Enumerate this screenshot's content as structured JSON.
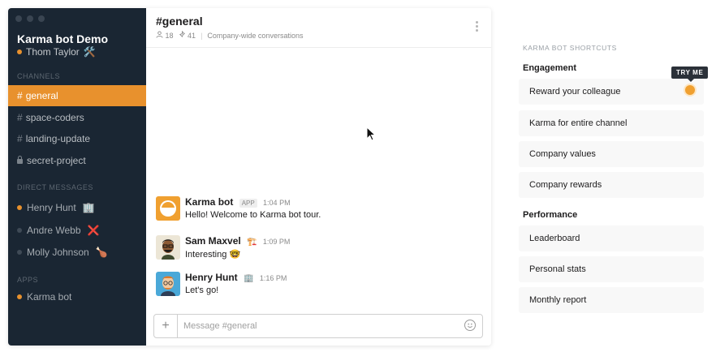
{
  "workspace": {
    "name": "Karma bot Demo",
    "user": "Thom Taylor",
    "user_emoji": "🛠️"
  },
  "sidebar": {
    "channels_title": "CHANNELS",
    "channels": [
      {
        "label": "general",
        "active": true,
        "private": false
      },
      {
        "label": "space-coders",
        "active": false,
        "private": false
      },
      {
        "label": "landing-update",
        "active": false,
        "private": false
      },
      {
        "label": "secret-project",
        "active": false,
        "private": true
      }
    ],
    "dm_title": "DIRECT MESSAGES",
    "dms": [
      {
        "label": "Henry Hunt",
        "emoji": "🏢",
        "online": true
      },
      {
        "label": "Andre Webb",
        "emoji": "❌",
        "online": false
      },
      {
        "label": "Molly Johnson",
        "emoji": "🍗",
        "online": false
      }
    ],
    "apps_title": "APPS",
    "apps": [
      {
        "label": "Karma bot",
        "online": true
      }
    ]
  },
  "header": {
    "channel": "#general",
    "members": "18",
    "pins": "41",
    "description": "Company-wide conversations"
  },
  "messages": [
    {
      "name": "Karma bot",
      "badge": "APP",
      "emoji": "",
      "time": "1:04 PM",
      "text": "Hello! Welcome to Karma bot tour.",
      "text_emoji": ""
    },
    {
      "name": "Sam Maxvel",
      "badge": "",
      "emoji": "🏗️",
      "time": "1:09 PM",
      "text": "Interesting",
      "text_emoji": "🤓"
    },
    {
      "name": "Henry Hunt",
      "badge": "",
      "emoji": "🏢",
      "time": "1:16 PM",
      "text": "Let's go!",
      "text_emoji": ""
    }
  ],
  "composer": {
    "placeholder": "Message #general"
  },
  "shortcuts": {
    "title": "KARMA BOT SHORTCUTS",
    "engagement_title": "Engagement",
    "engagement": [
      "Reward your colleague",
      "Karma for entire channel",
      "Company values",
      "Company rewards"
    ],
    "performance_title": "Performance",
    "performance": [
      "Leaderboard",
      "Personal stats",
      "Monthly report"
    ],
    "try_me": "TRY ME"
  },
  "colors": {
    "sidebar_bg": "#1a2633",
    "accent": "#e8912d"
  }
}
